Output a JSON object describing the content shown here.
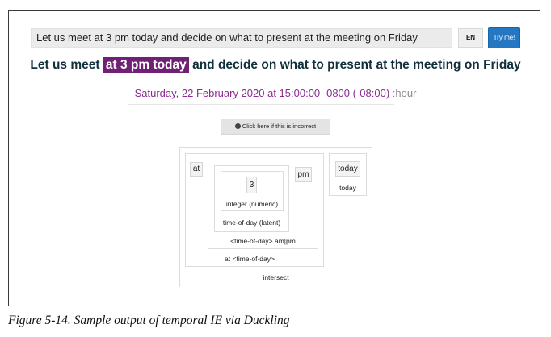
{
  "input": {
    "value": "Let us meet at 3 pm today and decide on what to present at the meeting on Friday"
  },
  "buttons": {
    "language": "EN",
    "try": "Try me!",
    "incorrect": "Click here if this is incorrect"
  },
  "sentence": {
    "before": "Let us meet ",
    "highlight": "at 3 pm today",
    "after": " and decide on what to present at the meeting on Friday"
  },
  "result": {
    "datetime": "Saturday, 22 February 2020 at 15:00:00 -0800 (-08:00)",
    "grain": ":hour"
  },
  "parse_tree": {
    "tokens": {
      "at": "at",
      "three": "3",
      "pm": "pm",
      "today": "today"
    },
    "labels": {
      "integer": "integer (numeric)",
      "time_latent": "time-of-day (latent)",
      "ampm": "<time-of-day> am|pm",
      "at_time": "at <time-of-day>",
      "today": "today",
      "intersect": "intersect"
    }
  },
  "caption": "Figure 5-14. Sample output of temporal IE via Duckling",
  "colors": {
    "try_button": "#2377c3",
    "highlight_bg": "#702075",
    "datetime_text": "#8b2b92"
  },
  "icons": {
    "info": "info-circle-icon"
  }
}
